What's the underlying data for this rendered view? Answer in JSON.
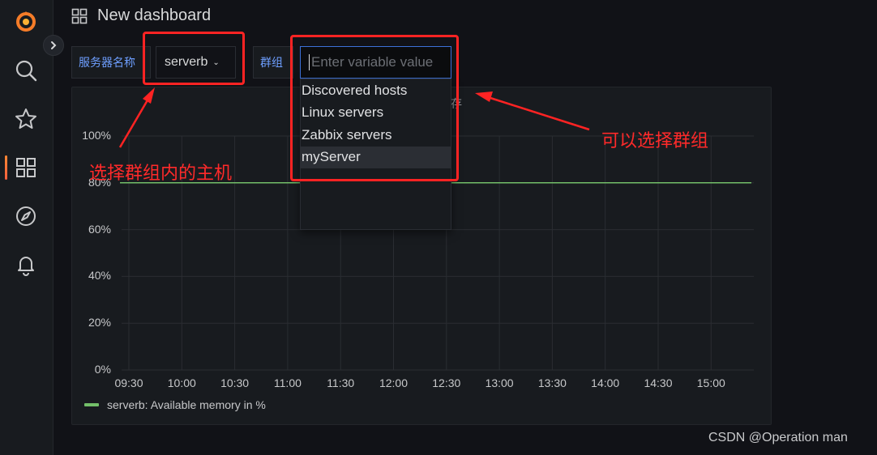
{
  "header": {
    "title": "New dashboard"
  },
  "variables": {
    "server_label": "服务器名称",
    "server_value": "serverb",
    "group_label": "群组",
    "group_placeholder": "Enter variable value"
  },
  "dropdown": {
    "options": [
      "Discovered hosts",
      "Linux servers",
      "Zabbix servers",
      "myServer"
    ],
    "highlighted": "myServer"
  },
  "panel": {
    "title_fragment": "存"
  },
  "chart_data": {
    "type": "line",
    "x": [
      "09:30",
      "10:00",
      "10:30",
      "11:00",
      "11:30",
      "12:00",
      "12:30",
      "13:00",
      "13:30",
      "14:00",
      "14:30",
      "15:00"
    ],
    "y_ticks": [
      "100%",
      "80%",
      "60%",
      "40%",
      "20%",
      "0%"
    ],
    "ylim": [
      0,
      100
    ],
    "grid": true,
    "series": [
      {
        "name": "serverb: Available memory in %",
        "values": [
          80,
          80,
          80,
          80,
          80,
          80,
          80,
          80,
          80,
          80,
          80,
          80,
          80
        ],
        "color": "#73bf69"
      }
    ],
    "legend": "bottom-left"
  },
  "annotations": {
    "left_note": "选择群组内的主机",
    "right_note": "可以选择群组",
    "color": "#ff2323"
  },
  "watermark": "CSDN @Operation man",
  "colors": {
    "background": "#111217",
    "panel": "#181b1f",
    "accent_blue": "#3d71d9",
    "label_blue": "#6e9fff",
    "series_green": "#73bf69"
  }
}
